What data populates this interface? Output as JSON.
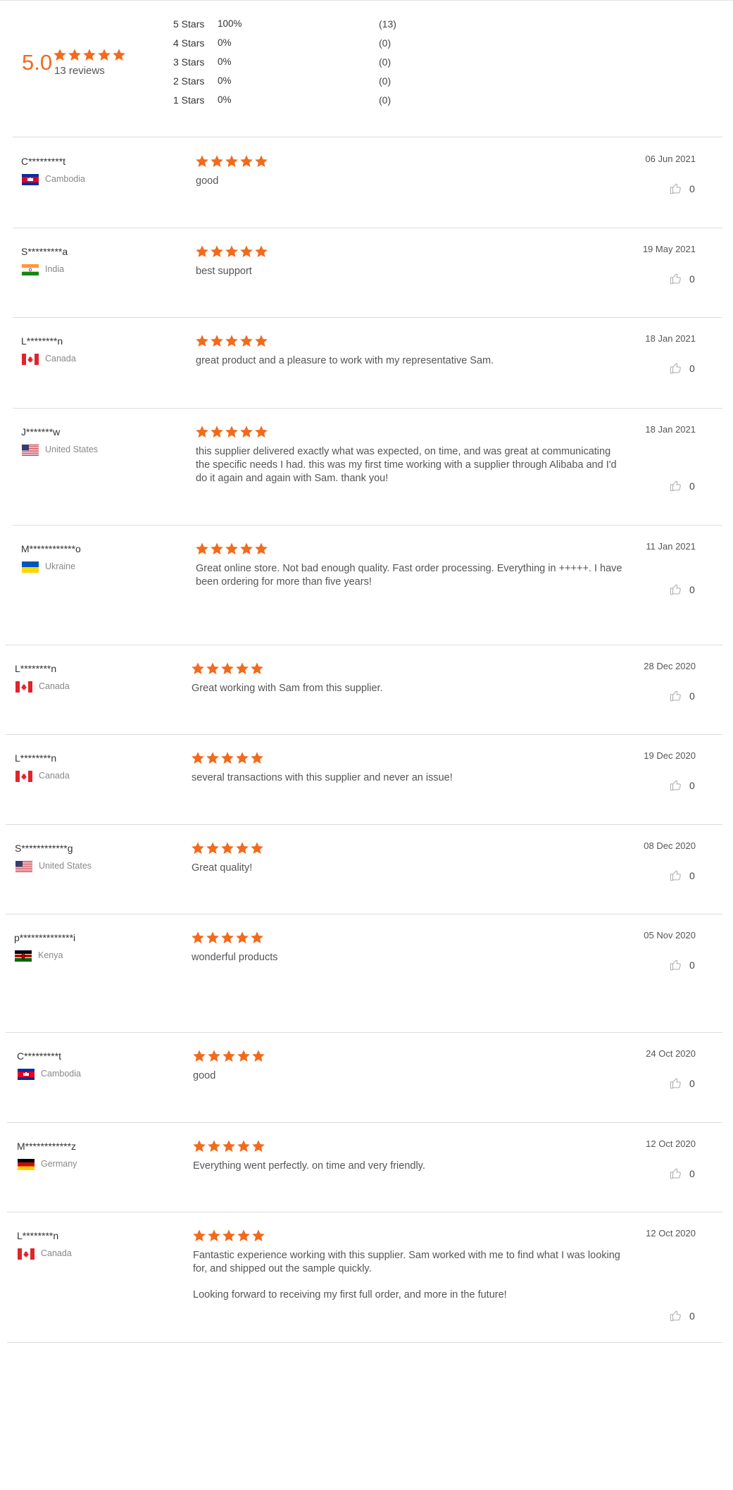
{
  "colors": {
    "accent": "#f26a1b",
    "divider": "#dcdcdc"
  },
  "summary": {
    "score": "5.0",
    "stars": 5,
    "reviews_label": "13 reviews",
    "breakdown": [
      {
        "label": "5  Stars",
        "percent": "100%",
        "count": "(13)"
      },
      {
        "label": "4  Stars",
        "percent": "0%",
        "count": "(0)"
      },
      {
        "label": "3  Stars",
        "percent": "0%",
        "count": "(0)"
      },
      {
        "label": "2  Stars",
        "percent": "0%",
        "count": "(0)"
      },
      {
        "label": "1  Stars",
        "percent": "0%",
        "count": "(0)"
      }
    ]
  },
  "reviews": [
    {
      "name": "C*********t",
      "country": "Cambodia",
      "flag": "cambodia-flag",
      "rating": 5,
      "date": "06 Jun 2021",
      "likes": "0",
      "text": [
        "good"
      ]
    },
    {
      "name": "S*********a",
      "country": "India",
      "flag": "india-flag",
      "rating": 5,
      "date": "19 May 2021",
      "likes": "0",
      "text": [
        "best support"
      ]
    },
    {
      "name": "L********n",
      "country": "Canada",
      "flag": "canada-flag",
      "rating": 5,
      "date": "18 Jan 2021",
      "likes": "0",
      "text": [
        "great product and a pleasure to work with my representative Sam."
      ]
    },
    {
      "name": "J*******w",
      "country": "United States",
      "flag": "usa-flag",
      "rating": 5,
      "date": "18 Jan 2021",
      "likes": "0",
      "text": [
        "this supplier delivered exactly what was expected, on time, and was great at communicating the specific needs I had. this was my first time working with a supplier through Alibaba and I'd do it again and again with Sam. thank you!"
      ]
    },
    {
      "name": "M************o",
      "country": "Ukraine",
      "flag": "ukraine-flag",
      "rating": 5,
      "date": "11 Jan 2021",
      "likes": "0",
      "text": [
        "Great online store. Not bad enough quality. Fast order processing. Everything in +++++. I have been ordering for more than five years!"
      ]
    },
    {
      "name": "L********n",
      "country": "Canada",
      "flag": "canada-flag",
      "rating": 5,
      "date": "28 Dec 2020",
      "likes": "0",
      "text": [
        "Great working with Sam from this supplier."
      ]
    },
    {
      "name": "L********n",
      "country": "Canada",
      "flag": "canada-flag",
      "rating": 5,
      "date": "19 Dec 2020",
      "likes": "0",
      "text": [
        "several transactions with this supplier and never an issue!"
      ]
    },
    {
      "name": "S************g",
      "country": "United States",
      "flag": "usa-flag",
      "rating": 5,
      "date": "08 Dec 2020",
      "likes": "0",
      "text": [
        "Great quality!"
      ]
    },
    {
      "name": "p**************i",
      "country": "Kenya",
      "flag": "kenya-flag",
      "rating": 5,
      "date": "05 Nov 2020",
      "likes": "0",
      "text": [
        "wonderful products"
      ]
    },
    {
      "name": "C*********t",
      "country": "Cambodia",
      "flag": "cambodia-flag",
      "rating": 5,
      "date": "24 Oct 2020",
      "likes": "0",
      "text": [
        "good"
      ]
    },
    {
      "name": "M************z",
      "country": "Germany",
      "flag": "germany-flag",
      "rating": 5,
      "date": "12 Oct 2020",
      "likes": "0",
      "text": [
        "Everything went perfectly. on time and very friendly."
      ]
    },
    {
      "name": "L********n",
      "country": "Canada",
      "flag": "canada-flag",
      "rating": 5,
      "date": "12 Oct 2020",
      "likes": "0",
      "text": [
        "Fantastic experience working with this supplier. Sam worked with me to find what I was looking for, and shipped out the sample quickly.",
        "Looking forward to receiving my first full order, and more in the future!"
      ]
    }
  ]
}
